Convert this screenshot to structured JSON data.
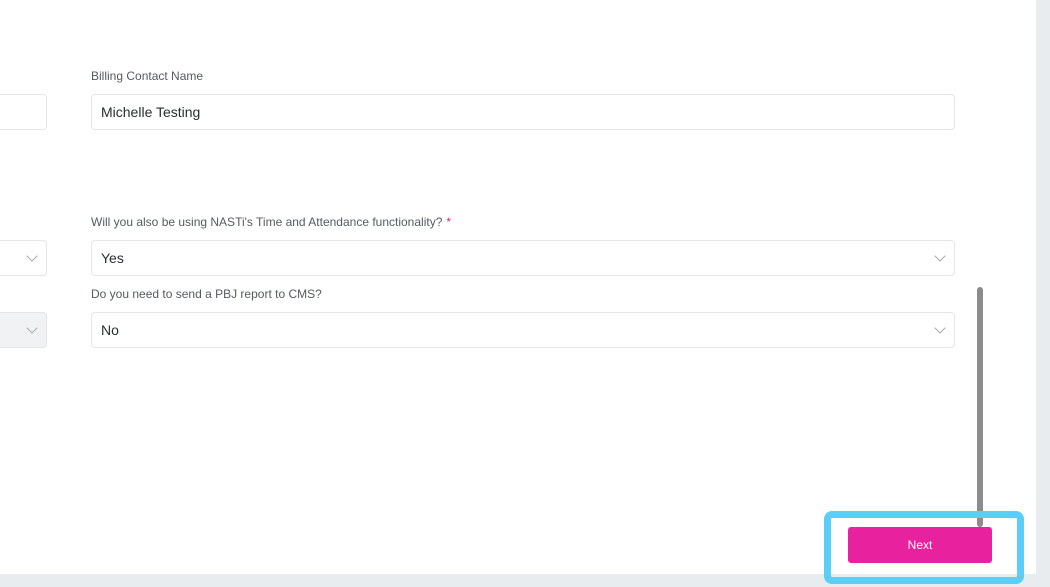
{
  "billing": {
    "label": "Billing Contact Name",
    "value": "Michelle Testing"
  },
  "time_attendance": {
    "label": "Will you also be using NASTi's Time and Attendance functionality?",
    "required_mark": "*",
    "value": "Yes"
  },
  "pbj": {
    "label": "Do you need to send a PBJ report to CMS?",
    "value": "No"
  },
  "footer": {
    "next_label": "Next"
  },
  "icons": {
    "dropdown": "chevron-down-icon"
  },
  "colors": {
    "accent": "#e8219e",
    "highlight": "#5ccdf4",
    "required": "#e0237f"
  }
}
